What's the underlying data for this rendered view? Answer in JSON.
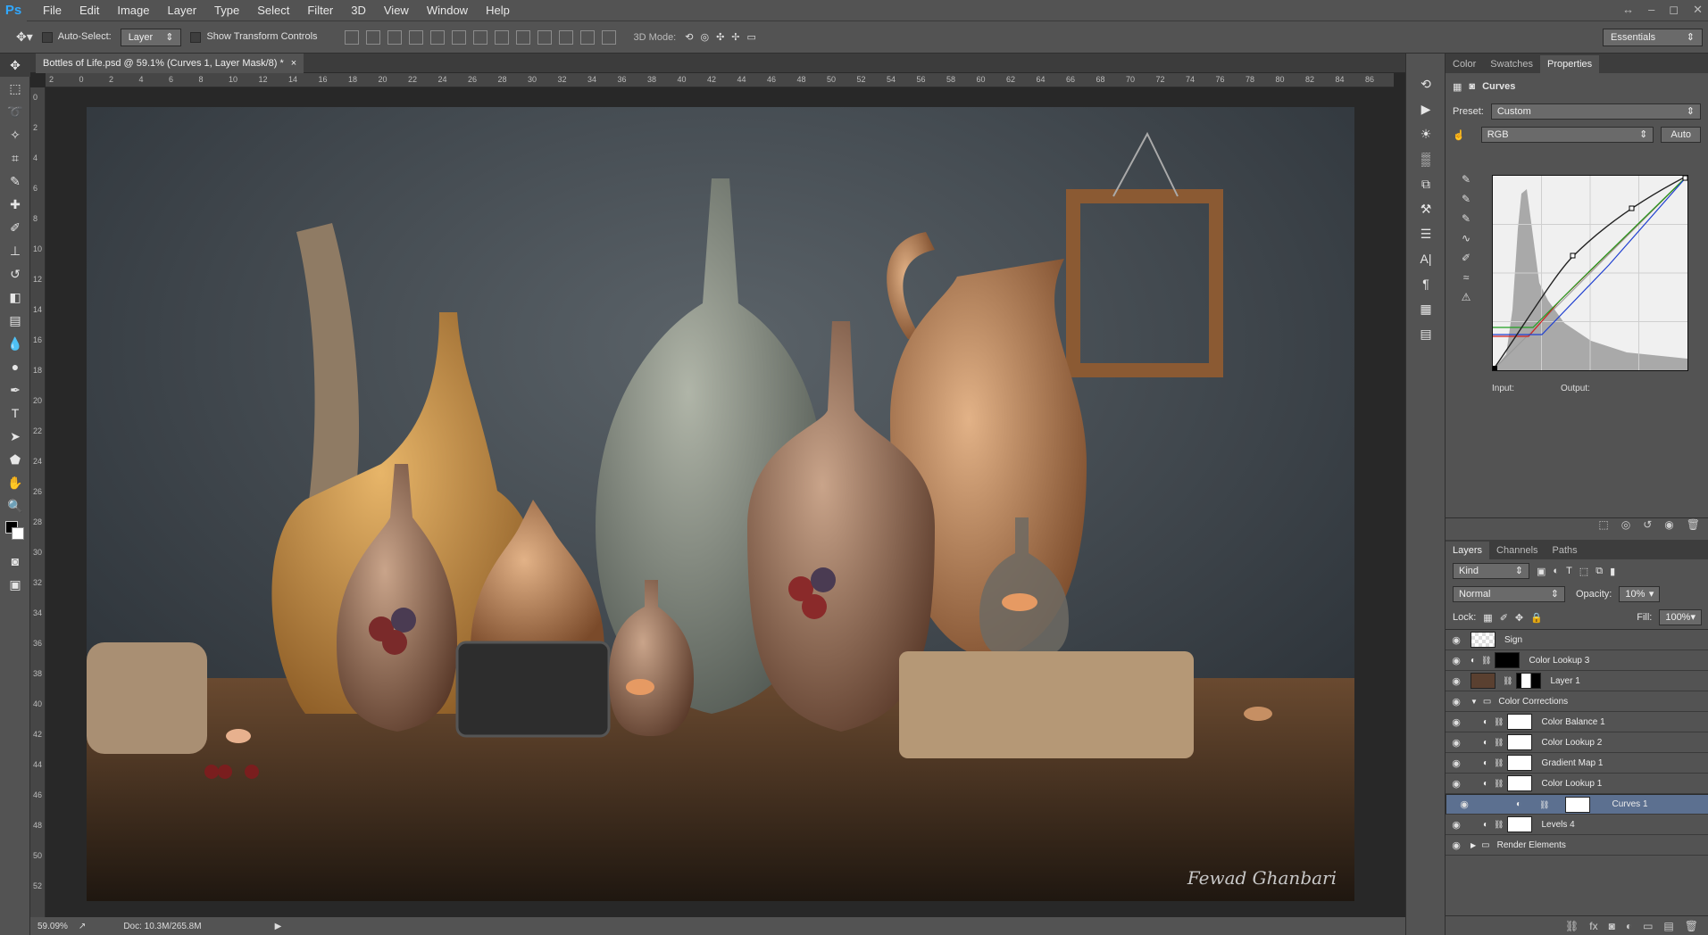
{
  "app": {
    "logo": "Ps",
    "window_controls": [
      "↔",
      "–",
      "◻",
      "✕"
    ]
  },
  "menu": [
    "File",
    "Edit",
    "Image",
    "Layer",
    "Type",
    "Select",
    "Filter",
    "3D",
    "View",
    "Window",
    "Help"
  ],
  "options": {
    "auto_select_label": "Auto-Select:",
    "auto_select_value": "Layer",
    "show_transform_label": "Show Transform Controls",
    "mode3d_label": "3D Mode:",
    "workspace": "Essentials"
  },
  "document": {
    "tab_title": "Bottles of Life.psd @ 59.1% (Curves 1, Layer Mask/8) *",
    "close": "×",
    "signature": "Fewad Ghanbari"
  },
  "ruler": {
    "h": [
      "2",
      "0",
      "2",
      "4",
      "6",
      "8",
      "10",
      "12",
      "14",
      "16",
      "18",
      "20",
      "22",
      "24",
      "26",
      "28",
      "30",
      "32",
      "34",
      "36",
      "38",
      "40",
      "42",
      "44",
      "46",
      "48",
      "50",
      "52",
      "54",
      "56",
      "58",
      "60",
      "62",
      "64",
      "66",
      "68",
      "70",
      "72",
      "74",
      "76",
      "78",
      "80",
      "82",
      "84",
      "86"
    ],
    "v": [
      "0",
      "2",
      "4",
      "6",
      "8",
      "10",
      "12",
      "14",
      "16",
      "18",
      "20",
      "22",
      "24",
      "26",
      "28",
      "30",
      "32",
      "34",
      "36",
      "38",
      "40",
      "42",
      "44",
      "46",
      "48",
      "50",
      "52"
    ]
  },
  "status": {
    "zoom": "59.09%",
    "doc": "Doc: 10.3M/265.8M"
  },
  "properties": {
    "tabs": [
      "Color",
      "Swatches",
      "Properties"
    ],
    "active_tab": "Properties",
    "panel_title": "Curves",
    "preset_label": "Preset:",
    "preset_value": "Custom",
    "channel_value": "RGB",
    "auto_label": "Auto",
    "input_label": "Input:",
    "output_label": "Output:"
  },
  "layers": {
    "tabs": [
      "Layers",
      "Channels",
      "Paths"
    ],
    "kind_label": "Kind",
    "blend_mode": "Normal",
    "opacity_label": "Opacity:",
    "opacity_value": "10%",
    "lock_label": "Lock:",
    "fill_label": "Fill:",
    "fill_value": "100%",
    "items": [
      {
        "name": "Sign",
        "type": "pixel",
        "indent": 0
      },
      {
        "name": "Color Lookup 3",
        "type": "adjustment",
        "indent": 0
      },
      {
        "name": "Layer 1",
        "type": "pixel-mask",
        "indent": 0
      },
      {
        "name": "Color Corrections",
        "type": "group-open",
        "indent": 0
      },
      {
        "name": "Color Balance 1",
        "type": "adjustment",
        "indent": 1
      },
      {
        "name": "Color Lookup 2",
        "type": "adjustment",
        "indent": 1
      },
      {
        "name": "Gradient Map 1",
        "type": "adjustment",
        "indent": 1
      },
      {
        "name": "Color Lookup 1",
        "type": "adjustment",
        "indent": 1
      },
      {
        "name": "Curves 1",
        "type": "adjustment",
        "indent": 1,
        "selected": true
      },
      {
        "name": "Levels 4",
        "type": "adjustment",
        "indent": 1
      },
      {
        "name": "Render Elements",
        "type": "group-closed",
        "indent": 0
      }
    ]
  },
  "colors": {
    "panel": "#535353",
    "dark": "#282828",
    "accent": "#31a8ff",
    "selection": "#5c7090"
  }
}
